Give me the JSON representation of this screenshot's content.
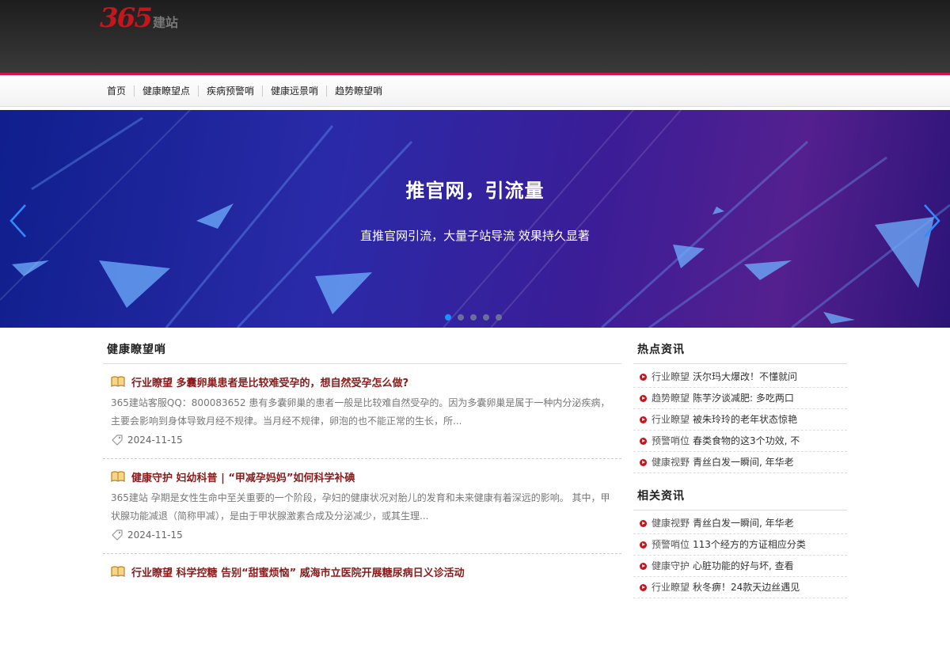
{
  "logo": {
    "number": "365",
    "word": "建站"
  },
  "nav": {
    "items": [
      "首页",
      "健康瞭望点",
      "疾病预警哨",
      "健康远景哨",
      "趋势瞭望哨"
    ]
  },
  "banner": {
    "title": "推官网，引流量",
    "subtitle": "直推官网引流，大量子站导流 效果持久显著",
    "slide_count": 5,
    "active_slide": 1
  },
  "main": {
    "section_title": "健康瞭望哨",
    "articles": [
      {
        "category": "行业瞭望",
        "title": "多囊卵巢患者是比较难受孕的，想自然受孕怎么做?",
        "desc": "365建站客服QQ：800083652 患有多囊卵巢的患者一般是比较难自然受孕的。因为多囊卵巢是属于一种内分泌疾病，主要会影响到身体导致月经不规律。当月经不规律，卵泡的也不能正常的生长，所...",
        "date": "2024-11-15"
      },
      {
        "category": "健康守护",
        "title": "妇幼科普 | “甲减孕妈妈”如何科学补碘",
        "desc": "365建站 孕期是女性生命中至关重要的一个阶段，孕妇的健康状况对胎儿的发育和未来健康有着深远的影响。 其中，甲状腺功能减退（简称甲减），是由于甲状腺激素合成及分泌减少，或其生理...",
        "date": "2024-11-15"
      },
      {
        "category": "行业瞭望",
        "title": "科学控糖 告别“甜蜜烦恼” 威海市立医院开展糖尿病日义诊活动",
        "desc": "",
        "date": ""
      }
    ]
  },
  "sidebar": {
    "hot": {
      "title": "热点资讯",
      "items": [
        {
          "category": "行业瞭望",
          "text": "沃尔玛大爆改！不懂就问"
        },
        {
          "category": "趋势瞭望",
          "text": "陈芋汐谈减肥: 多吃两口"
        },
        {
          "category": "行业瞭望",
          "text": "被朱玲玲的老年状态惊艳"
        },
        {
          "category": "预警哨位",
          "text": "春类食物的这3个功效, 不"
        },
        {
          "category": "健康视野",
          "text": "青丝白发一瞬间, 年华老"
        }
      ]
    },
    "related": {
      "title": "相关资讯",
      "items": [
        {
          "category": "健康视野",
          "text": "青丝白发一瞬间, 年华老"
        },
        {
          "category": "预警哨位",
          "text": "113个经方的方证相应分类"
        },
        {
          "category": "健康守护",
          "text": "心脏功能的好与坏, 查看"
        },
        {
          "category": "行业瞭望",
          "text": "秋冬痹！24款天边丝遇见"
        }
      ]
    }
  },
  "colors": {
    "accent": "#d0164a",
    "title_red": "#8b1a1a",
    "dot_active": "#1e90ff"
  }
}
